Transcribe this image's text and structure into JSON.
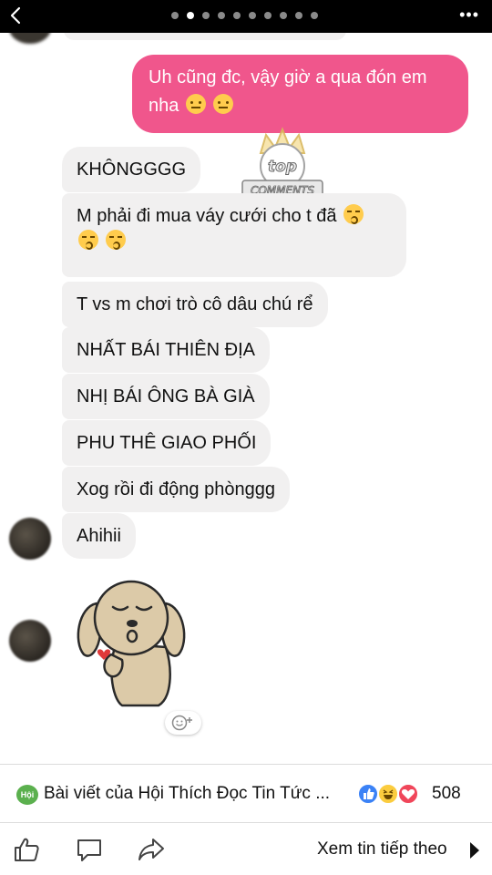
{
  "status_bar": {
    "page_dots_total": 10,
    "page_dots_active_index": 1
  },
  "chat": {
    "outgoing": {
      "text": "Uh cũng đc, vậy giờ a qua đón em nha",
      "emojis": [
        "neutral-face",
        "neutral-face"
      ]
    },
    "incoming": [
      {
        "text": "KHÔNGGGG"
      },
      {
        "text": "M phải đi mua váy cưới cho t đã",
        "emojis": [
          "kissing-face-closed-eyes",
          "kissing-face-closed-eyes",
          "kissing-face-closed-eyes"
        ]
      },
      {
        "text": "T vs m chơi trò cô dâu chú rể"
      },
      {
        "text": "NHẤT BÁI THIÊN ĐỊA"
      },
      {
        "text": "NHỊ BÁI ÔNG BÀ GIÀ"
      },
      {
        "text": "PHU THÊ GIAO PHỐI"
      },
      {
        "text": "Xog rồi đi động phònggg"
      },
      {
        "text": "Ahihii"
      }
    ],
    "sticker": "puppy-blowing-kiss-sticker",
    "watermark": "top comments"
  },
  "post_info": {
    "page_icon_label": "Hội",
    "title": "Bài viết của Hội Thích Đọc Tin Tức ...",
    "reaction_count": "508",
    "reactions": [
      "like",
      "haha",
      "love"
    ],
    "colors": {
      "like": "#3b82f6",
      "haha": "#fbcc3e",
      "love": "#f0465a",
      "outgoing_bubble": "#f0568c"
    }
  },
  "actions": {
    "like_icon": "thumbs-up-icon",
    "comment_icon": "comment-icon",
    "share_icon": "share-icon",
    "next_label": "Xem tin tiếp theo"
  }
}
